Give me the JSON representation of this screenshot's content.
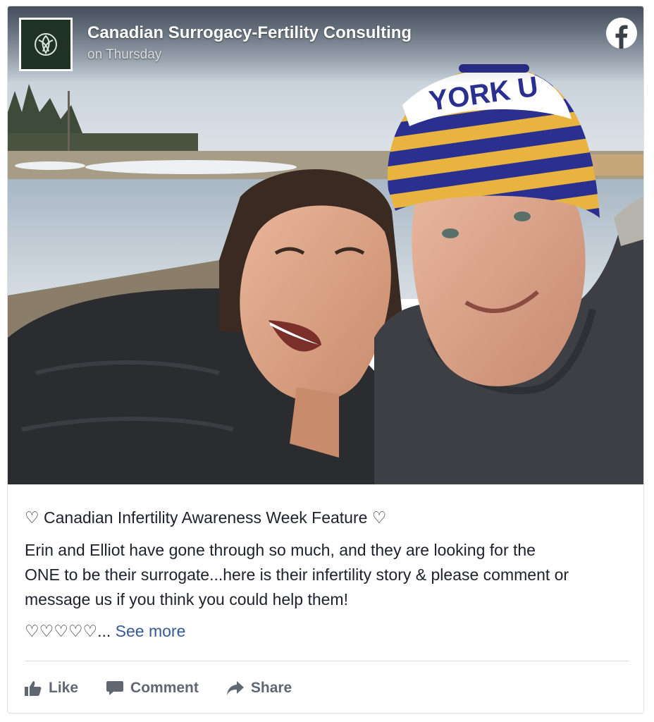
{
  "post": {
    "page_name": "Canadian Surrogacy-Fertility Consulting",
    "timestamp": "on Thursday",
    "photo_icon": "couple-selfie-photo",
    "avatar_icon": "leaf-logo-icon",
    "brand_icon": "facebook-icon",
    "title_line": "♡ Canadian Infertility Awareness Week Feature ♡",
    "body_line_1": "Erin and Elliot have gone through so much, and they are looking for the",
    "body_line_2": "ONE to be their surrogate...here is their infertility story & please comment or",
    "body_line_3": "message us if you think you could help them!",
    "hearts": "♡♡♡♡♡...",
    "see_more": "See more",
    "beanie_text": "YORK U"
  },
  "actions": {
    "like_label": "Like",
    "comment_label": "Comment",
    "share_label": "Share"
  },
  "colors": {
    "link": "#385898",
    "action_gray": "#606770",
    "text": "#1d2129",
    "facebook_white": "#ffffff"
  }
}
